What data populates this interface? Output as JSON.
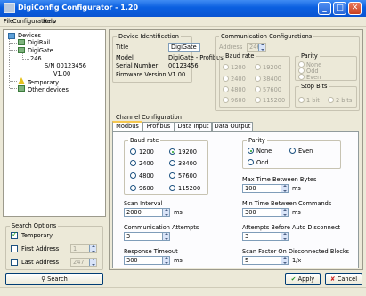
{
  "window": {
    "title": "DigiConfig Configurator - 1.20"
  },
  "menu": [
    "File",
    "Configurations",
    "Help"
  ],
  "tree": {
    "root": "Devices",
    "items": [
      "DigiRail",
      "DigiGate",
      "246",
      "S/N 00123456",
      "V1.00",
      "Temporary",
      "Other devices"
    ]
  },
  "search": {
    "title": "Search Options",
    "temporary_label": "Temporary",
    "temporary_checked": true,
    "first_address_label": "First Address",
    "first_address_value": "1",
    "last_address_label": "Last Address",
    "last_address_value": "247",
    "button": "Search"
  },
  "device": {
    "group_label": "Device Identification",
    "title_label": "Title",
    "title_value": "DigiGate",
    "model_label": "Model",
    "model_value": "DigiGate - Profibus",
    "serial_label": "Serial Number",
    "serial_value": "00123456",
    "firmware_label": "Firmware Version",
    "firmware_value": "V1.00"
  },
  "comm": {
    "group_label": "Communication Configurations",
    "address_label": "Address",
    "address_value": "246",
    "baud_label": "Baud rate",
    "baud_options": [
      "1200",
      "2400",
      "4800",
      "9600",
      "19200",
      "38400",
      "57600",
      "115200"
    ],
    "parity_label": "Parity",
    "parity_options": [
      "None",
      "Odd",
      "Even"
    ],
    "stop_label": "Stop Bits",
    "stop_options": [
      "1 bit",
      "2 bits"
    ]
  },
  "channel": {
    "group_label": "Channel Configuration",
    "tabs": [
      "Modbus",
      "Profibus",
      "Data Input",
      "Data Output"
    ],
    "baud_label": "Baud rate",
    "baud_options": [
      "1200",
      "2400",
      "4800",
      "9600",
      "19200",
      "38400",
      "57600",
      "115200"
    ],
    "baud_selected": "19200",
    "parity_label": "Parity",
    "parity_options": [
      "None",
      "Even",
      "Odd"
    ],
    "parity_selected": "None",
    "scan_interval_label": "Scan Interval",
    "scan_interval_value": "2000",
    "scan_interval_unit": "ms",
    "comm_attempts_label": "Communication Attempts",
    "comm_attempts_value": "3",
    "response_timeout_label": "Response Timeout",
    "response_timeout_value": "300",
    "response_timeout_unit": "ms",
    "max_time_label": "Max Time Between Bytes",
    "max_time_value": "100",
    "max_time_unit": "ms",
    "min_time_label": "Min Time Between Commands",
    "min_time_value": "300",
    "min_time_unit": "ms",
    "attempts_disconnect_label": "Attempts Before Auto Disconnect",
    "attempts_disconnect_value": "3",
    "scan_factor_label": "Scan Factor On Disconnected Blocks",
    "scan_factor_value": "5",
    "scan_factor_unit": "1/x"
  },
  "buttons": {
    "apply": "Apply",
    "cancel": "Cancel"
  }
}
